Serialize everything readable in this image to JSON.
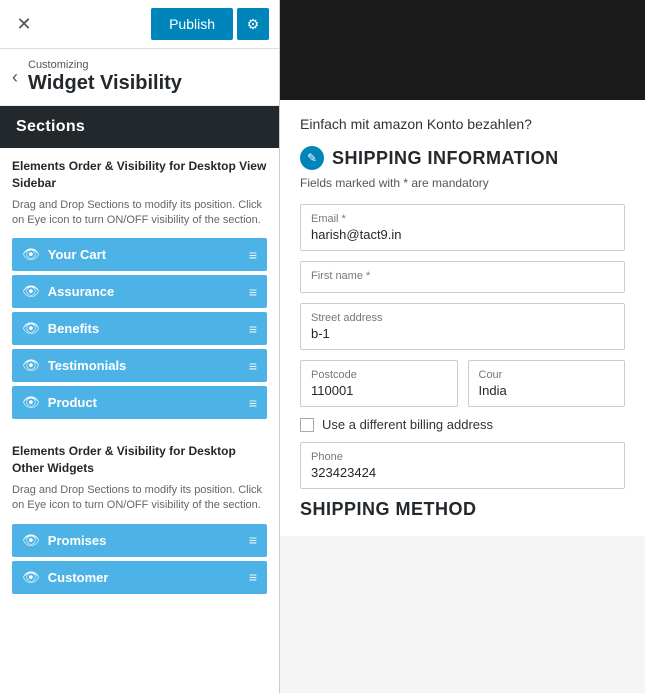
{
  "topbar": {
    "close_label": "✕",
    "publish_label": "Publish",
    "gear_label": "⚙"
  },
  "breadcrumb": {
    "back_label": "‹",
    "sub_label": "Customizing",
    "title_label": "Widget Visibility"
  },
  "sections": {
    "header_label": "Sections",
    "group1": {
      "title": "Elements Order & Visibility for Desktop View Sidebar",
      "desc": "Drag and Drop Sections to modify its position. Click on Eye icon to turn ON/OFF visibility of the section.",
      "items": [
        {
          "label": "Your Cart"
        },
        {
          "label": "Assurance"
        },
        {
          "label": "Benefits"
        },
        {
          "label": "Testimonials"
        },
        {
          "label": "Product"
        }
      ]
    },
    "group2": {
      "title": "Elements Order & Visibility for Desktop Other Widgets",
      "desc": "Drag and Drop Sections to modify its position. Click on Eye icon to turn ON/OFF visibility of the section.",
      "items": [
        {
          "label": "Promises"
        },
        {
          "label": "Customer"
        }
      ]
    }
  },
  "right_panel": {
    "amazon_text": "Einfach mit amazon Konto bezahlen?",
    "shipping_title": "SHIPPING INFORMATION",
    "mandatory_text": "Fields marked with * are mandatory",
    "fields": {
      "email_label": "Email *",
      "email_value": "harish@tact9.in",
      "firstname_label": "First name *",
      "firstname_value": "",
      "street_label": "Street address",
      "street_value": "b-1",
      "postcode_label": "Postcode",
      "postcode_value": "110001",
      "country_label": "Cour",
      "country_value": "India",
      "billing_label": "Use a different billing address",
      "phone_label": "Phone",
      "phone_value": "323423424",
      "shipping_method_title": "SHIPPING METHOD"
    }
  },
  "icons": {
    "eye": "👁",
    "hamburger": "≡",
    "edit": "✎"
  }
}
